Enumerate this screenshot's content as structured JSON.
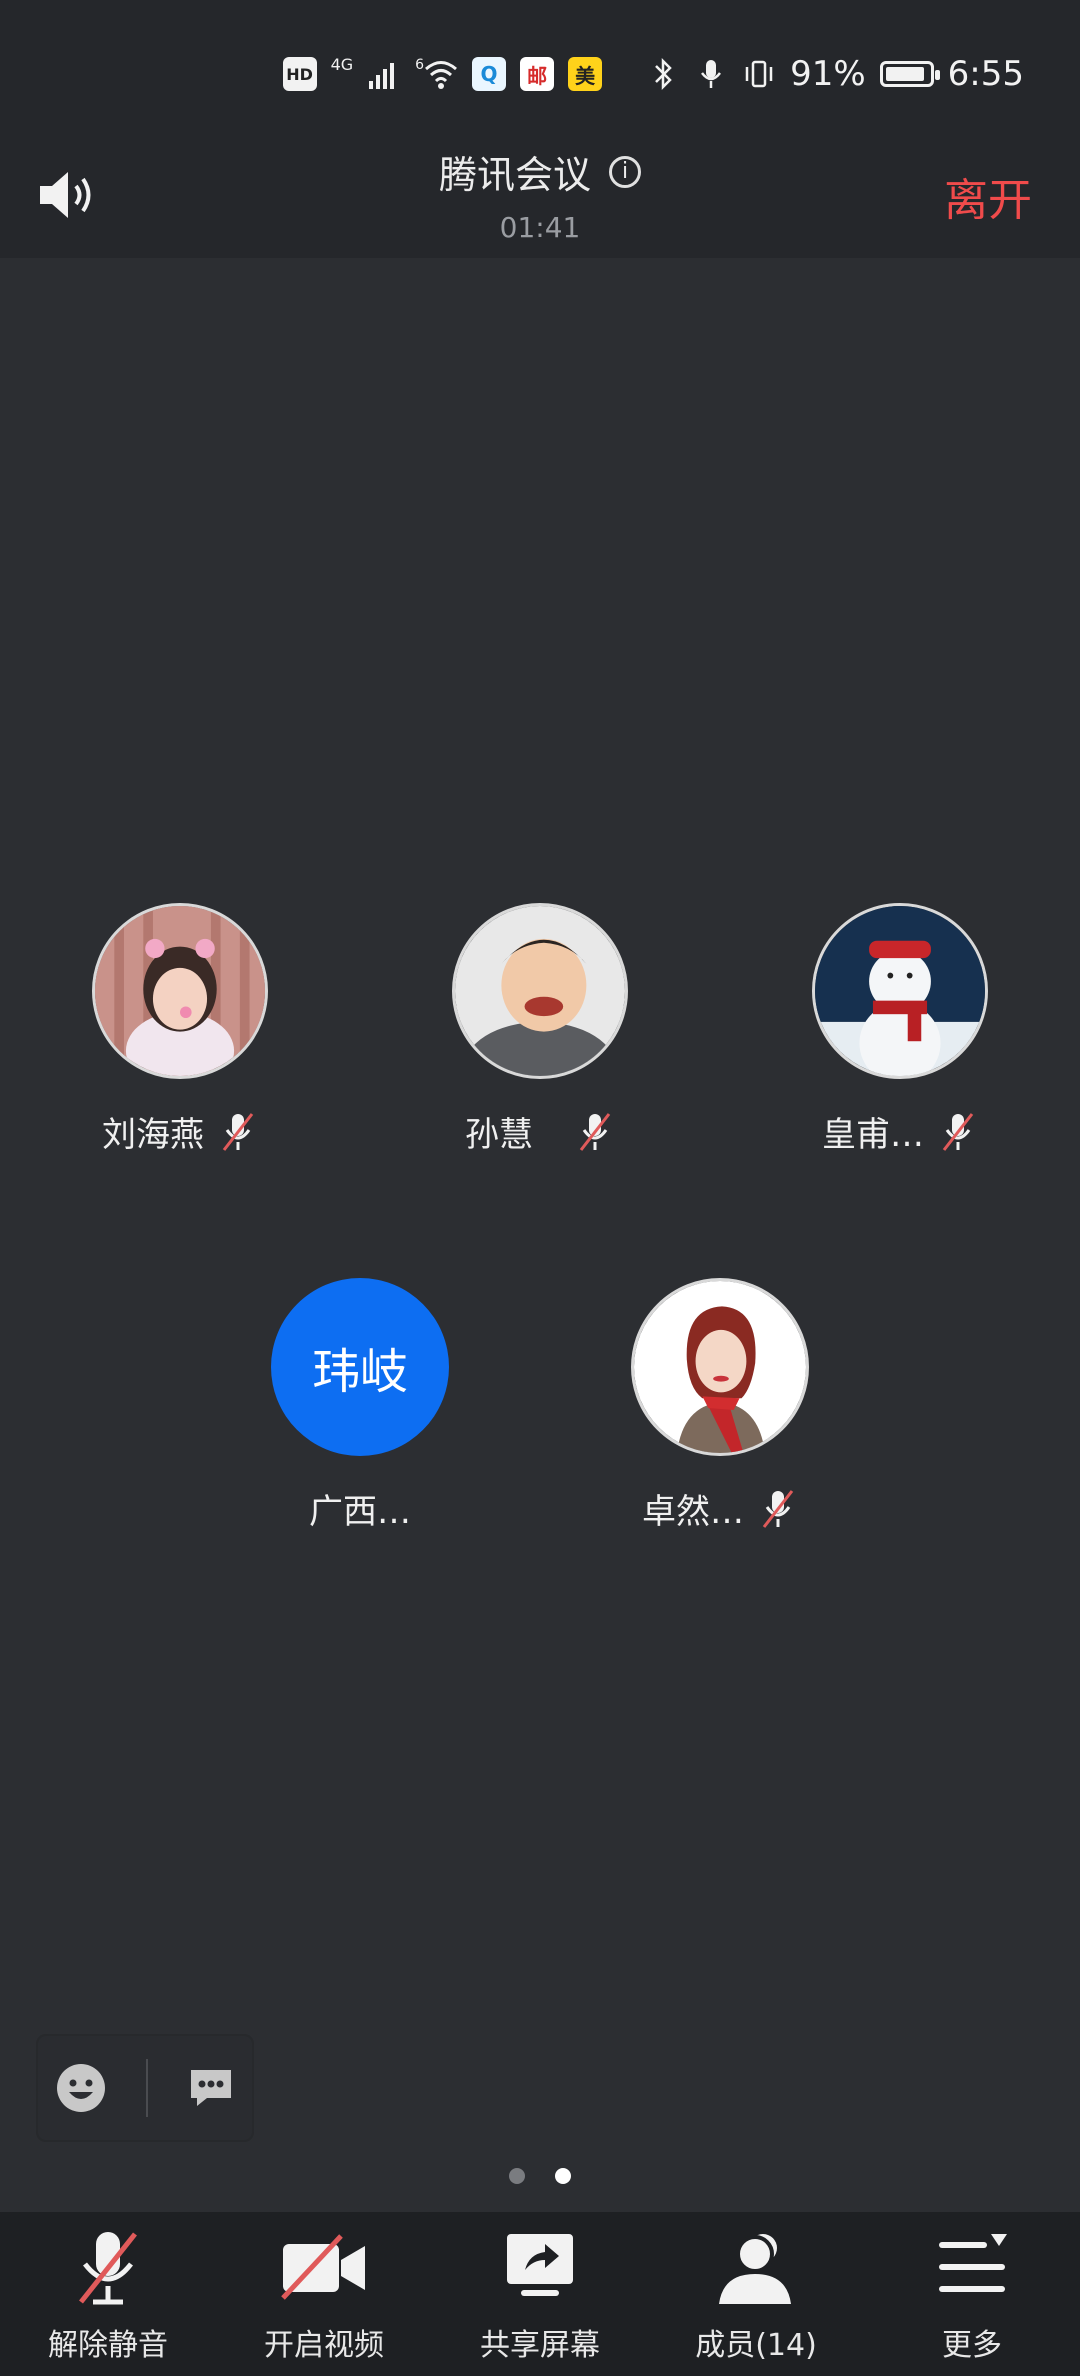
{
  "status_bar": {
    "hd": "HD",
    "net": "4G",
    "wifi_tag": "6",
    "app_badges": [
      "Q",
      "邮",
      "美"
    ],
    "battery": "91%",
    "battery_level": 0.91,
    "time": "6:55"
  },
  "header": {
    "title": "腾讯会议",
    "timer": "01:41",
    "leave": "离开",
    "leave_color": "#f04b4b"
  },
  "participants": [
    {
      "name": "刘海燕",
      "avatar": "photo-girl",
      "muted": true
    },
    {
      "name": "孙慧",
      "avatar": "photo-boy",
      "muted": true
    },
    {
      "name": "皇甫…",
      "avatar": "photo-snowman",
      "muted": true
    },
    {
      "name": "广西…",
      "avatar_text": "玮岐",
      "muted": false
    },
    {
      "name": "卓然…",
      "avatar": "illustration-woman",
      "muted": true
    }
  ],
  "pager": {
    "pages": 2,
    "current": 2
  },
  "toolbar": {
    "unmute": "解除静音",
    "video": "开启视频",
    "share": "共享屏幕",
    "members": "成员(14)",
    "more": "更多"
  },
  "colors": {
    "accent": "#0d6ef2",
    "background": "#2c2e32",
    "muted_slash": "#e05a5a"
  }
}
